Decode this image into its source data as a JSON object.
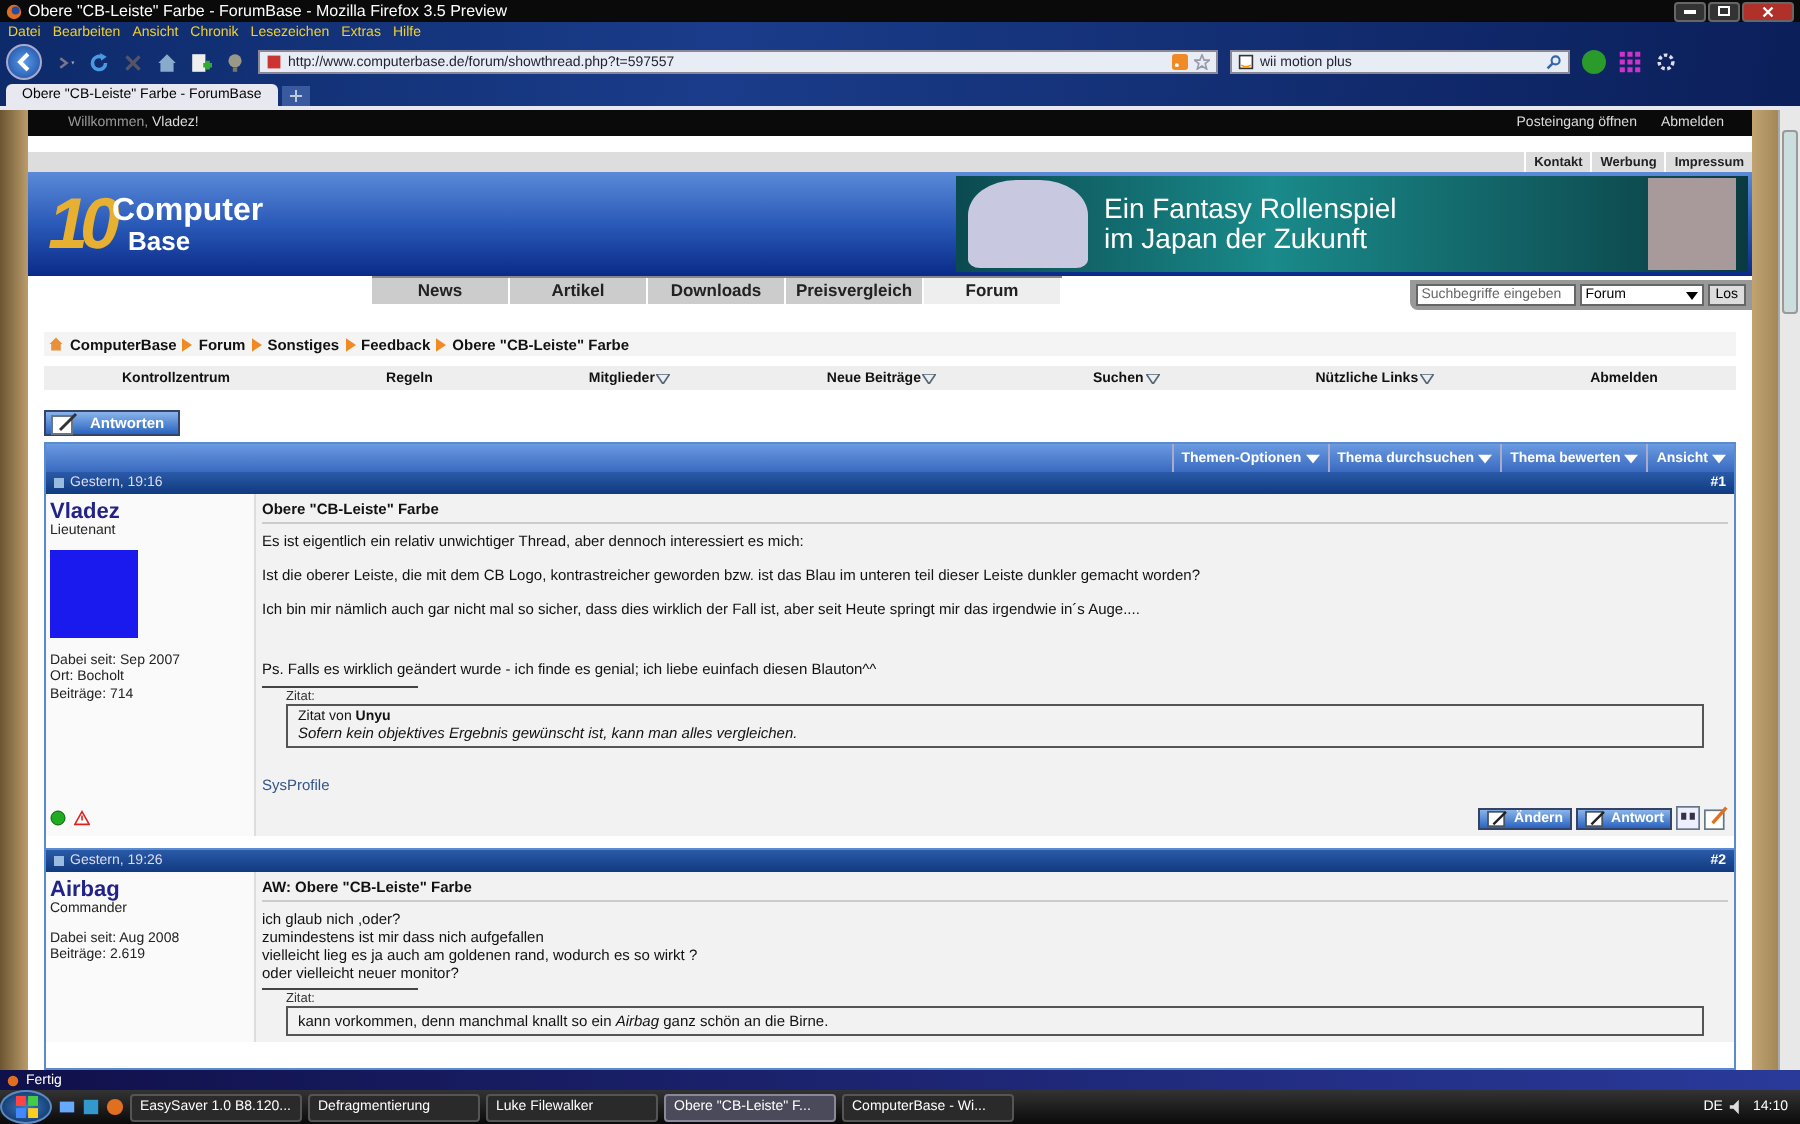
{
  "window": {
    "title": "Obere \"CB-Leiste\" Farbe - ForumBase - Mozilla Firefox 3.5 Preview"
  },
  "menu": [
    "Datei",
    "Bearbeiten",
    "Ansicht",
    "Chronik",
    "Lesezeichen",
    "Extras",
    "Hilfe"
  ],
  "address": "http://www.computerbase.de/forum/showthread.php?t=597557",
  "search": {
    "value": "wii motion plus"
  },
  "tabs": [
    {
      "label": "Obere \"CB-Leiste\" Farbe - ForumBase",
      "selected": true
    }
  ],
  "welcome": {
    "greeting": "Willkommen,",
    "user": "Vladez!",
    "links": [
      "Posteingang öffnen",
      "Abmelden"
    ]
  },
  "top_links": [
    "Kontakt",
    "Werbung",
    "Impressum"
  ],
  "logo": {
    "number": "10",
    "line1": "Computer",
    "line2": "Base"
  },
  "banner": {
    "line1": "Ein Fantasy Rollenspiel",
    "line2": "im Japan der Zukunft"
  },
  "nav": [
    {
      "label": "News",
      "selected": false
    },
    {
      "label": "Artikel",
      "selected": false
    },
    {
      "label": "Downloads",
      "selected": false
    },
    {
      "label": "Preisvergleich",
      "selected": false
    },
    {
      "label": "Forum",
      "selected": true
    }
  ],
  "site_search": {
    "placeholder": "Suchbegriffe eingeben",
    "scope": "Forum",
    "button": "Los"
  },
  "breadcrumb": [
    "ComputerBase",
    "Forum",
    "Sonstiges",
    "Feedback",
    "Obere \"CB-Leiste\" Farbe"
  ],
  "forum_menu": [
    {
      "label": "Kontrollzentrum",
      "dropdown": false
    },
    {
      "label": "Regeln",
      "dropdown": false
    },
    {
      "label": "Mitglieder",
      "dropdown": true
    },
    {
      "label": "Neue Beiträge",
      "dropdown": true
    },
    {
      "label": "Suchen",
      "dropdown": true
    },
    {
      "label": "Nützliche Links",
      "dropdown": true
    },
    {
      "label": "Abmelden",
      "dropdown": false
    }
  ],
  "reply_button": "Antworten",
  "thread_tools": [
    "Themen-Optionen",
    "Thema durchsuchen",
    "Thema bewerten",
    "Ansicht"
  ],
  "posts": [
    {
      "date": "Gestern, 19:16",
      "number": "#1",
      "user": "Vladez",
      "rank": "Lieutenant",
      "avatar": true,
      "info": [
        "Dabei seit: Sep 2007",
        "Ort: Bocholt",
        "Beiträge: 714"
      ],
      "title": "Obere \"CB-Leiste\" Farbe",
      "kind": "paragraphs",
      "body": [
        "Es ist eigentlich ein relativ unwichtiger Thread, aber dennoch interessiert es mich:",
        "Ist die oberer Leiste, die mit dem CB Logo, kontrastreicher geworden bzw. ist das Blau im unteren teil dieser Leiste dunkler gemacht worden?",
        "Ich bin mir nämlich auch gar nicht mal so sicher, dass dies wirklich der Fall ist, aber seit Heute springt mir das irgendwie in´s Auge....",
        "Ps. Falls es wirklich geändert wurde - ich finde es genial; ich liebe euinfach diesen Blauton^^"
      ],
      "quote": {
        "label": "Zitat:",
        "author_prefix": "Zitat von",
        "author": "Unyu",
        "text": "*Sofern kein objektives Ergebnis gewünscht ist, kann man alles vergleichen.*"
      },
      "signature": "SysProfile",
      "online": true,
      "buttons": [
        "Ändern",
        "Antwort"
      ]
    },
    {
      "date": "Gestern, 19:26",
      "number": "#2",
      "user": "Airbag",
      "rank": "Commander",
      "avatar": false,
      "info": [
        "Dabei seit: Aug 2008",
        "Beiträge: 2.619"
      ],
      "title": "AW: Obere \"CB-Leiste\" Farbe",
      "kind": "lines",
      "body": [
        "ich glaub nich ,oder?",
        "zumindestens ist mir dass nich aufgefallen",
        "vielleicht lieg es ja auch am goldenen rand, wodurch es so wirkt ?",
        "oder vielleicht neuer monitor?"
      ],
      "quote": {
        "label": "Zitat:",
        "text": "kann vorkommen, denn manchmal knallt so ein *Airbag* ganz schön an die Birne."
      }
    }
  ],
  "status_bar": "Fertig",
  "taskbar": {
    "items": [
      {
        "label": "EasySaver 1.0 B8.120...",
        "selected": false
      },
      {
        "label": "Defragmentierung",
        "selected": false
      },
      {
        "label": "Luke Filewalker",
        "selected": false
      },
      {
        "label": "Obere \"CB-Leiste\" F...",
        "selected": true
      },
      {
        "label": "ComputerBase - Wi...",
        "selected": false
      }
    ],
    "language": "DE",
    "time": "14:10"
  }
}
